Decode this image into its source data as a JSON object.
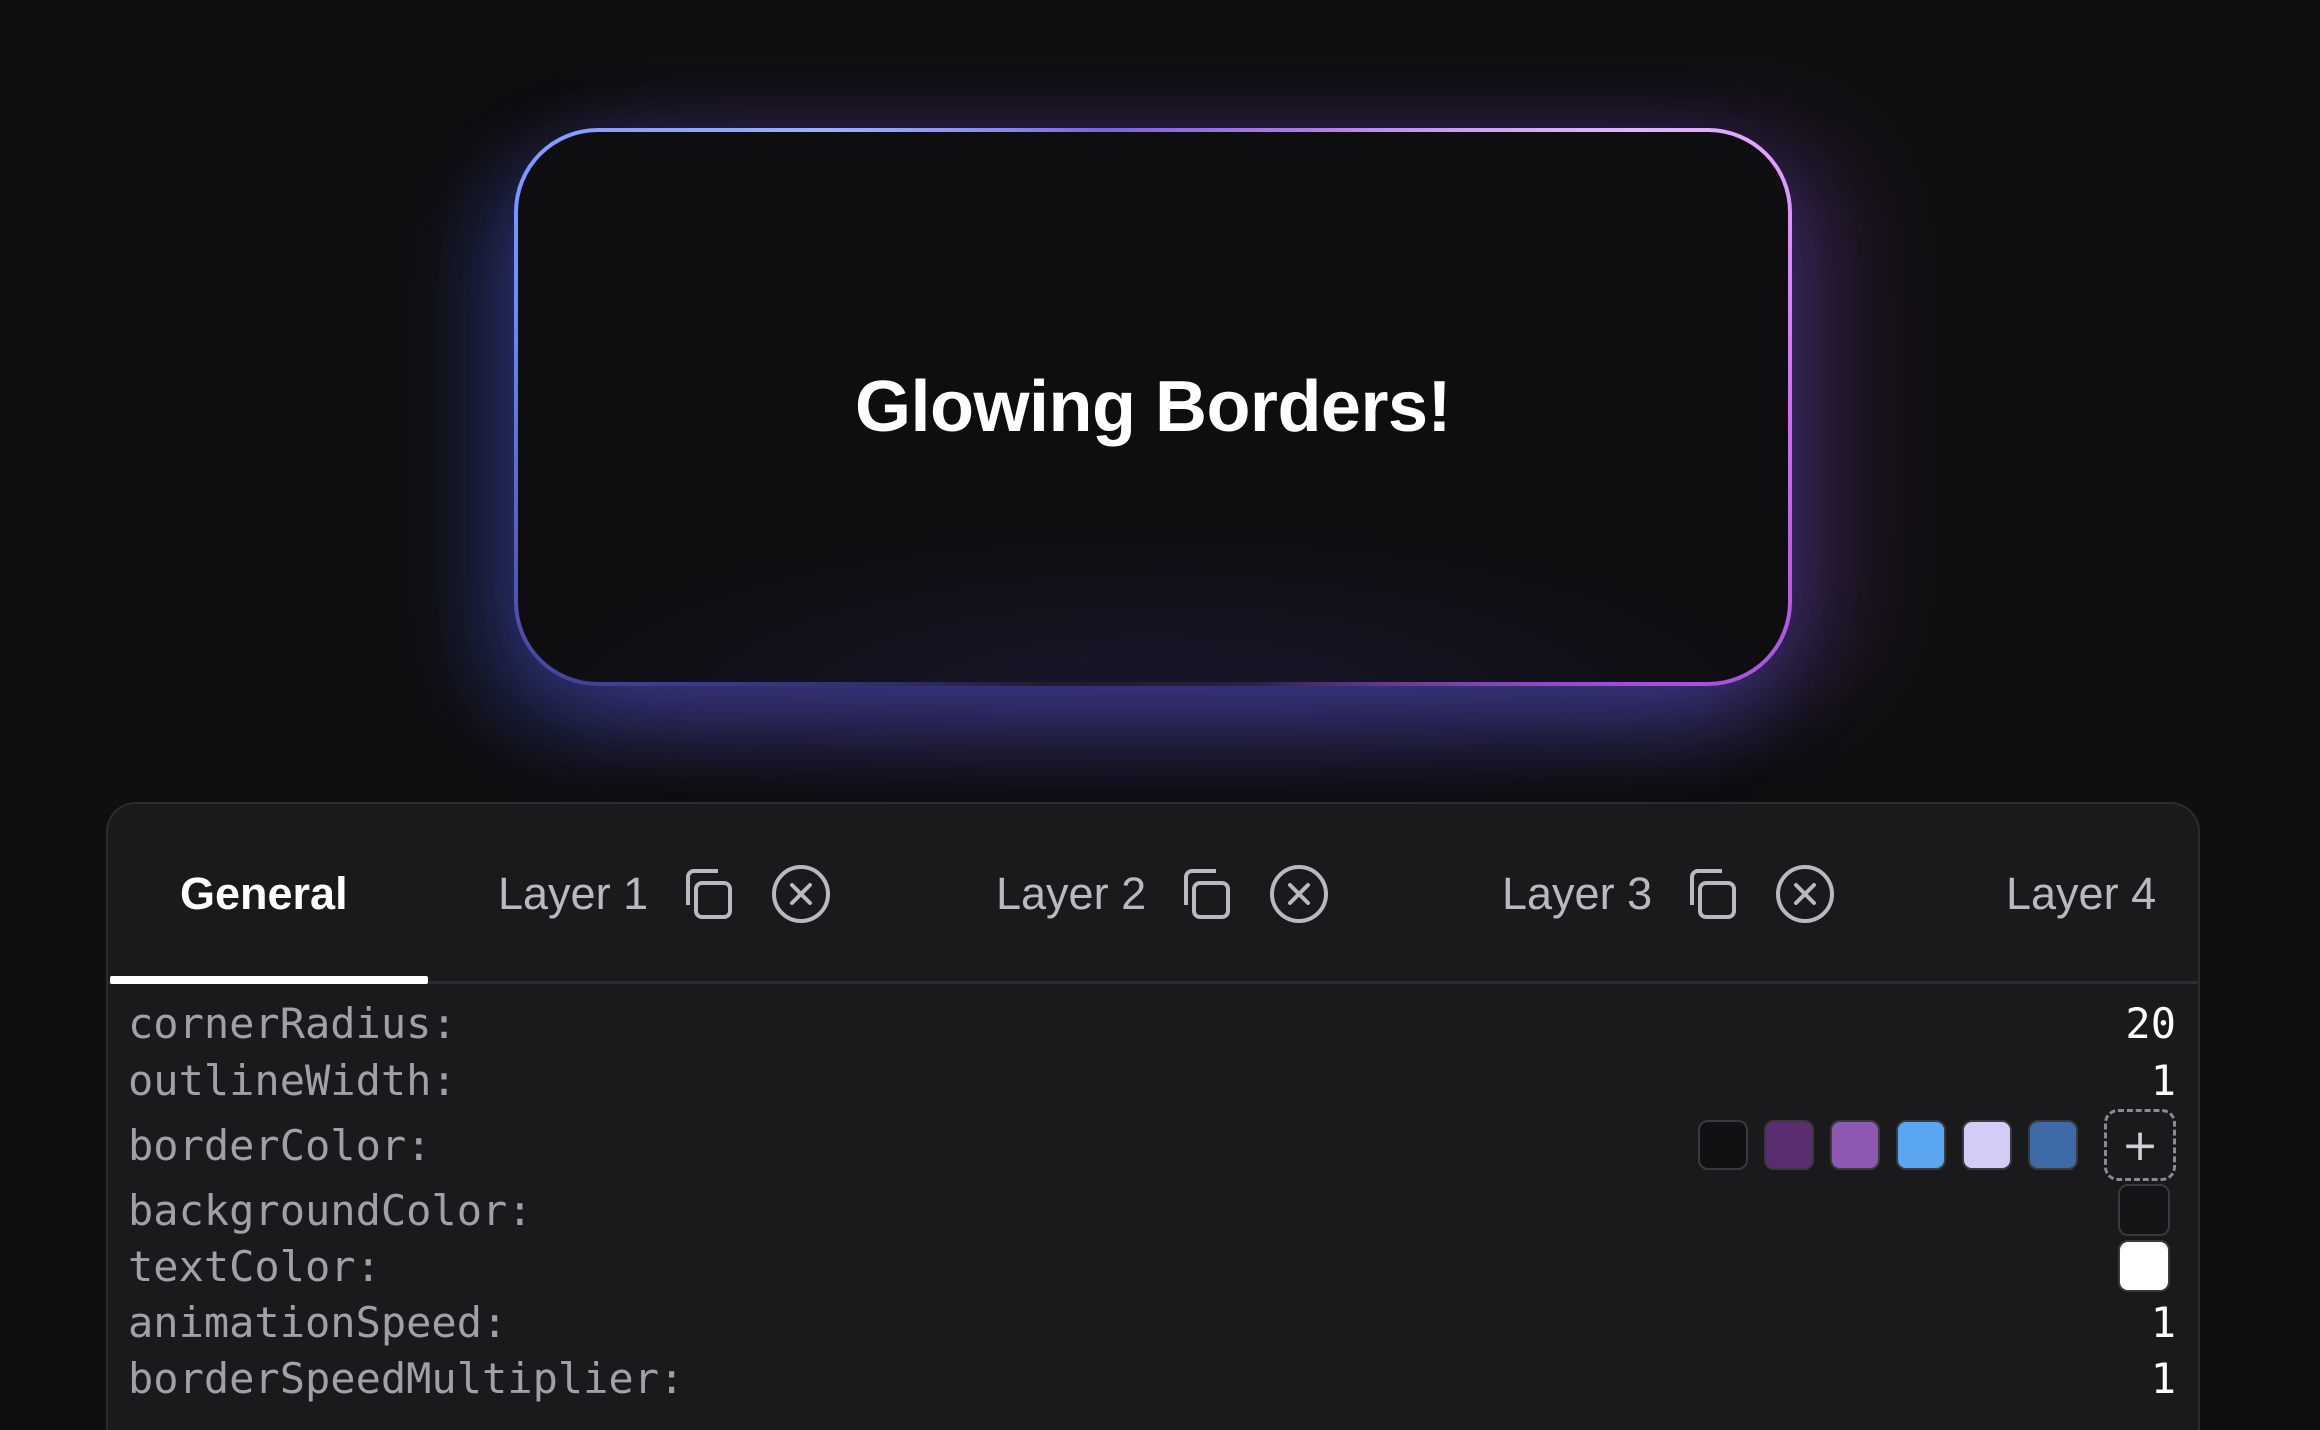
{
  "card": {
    "title": "Glowing Borders!"
  },
  "tabs": [
    {
      "label": "General",
      "active": true
    },
    {
      "label": "Layer 1",
      "active": false
    },
    {
      "label": "Layer 2",
      "active": false
    },
    {
      "label": "Layer 3",
      "active": false
    },
    {
      "label": "Layer 4",
      "active": false
    }
  ],
  "settings": {
    "cornerRadius": {
      "label": "cornerRadius:",
      "value": "20"
    },
    "outlineWidth": {
      "label": "outlineWidth:",
      "value": "1"
    },
    "borderColor": {
      "label": "borderColor:",
      "colors": [
        "#111113",
        "#5a2d6e",
        "#8e58b3",
        "#5aa6f0",
        "#d2cdf7",
        "#3f6aa8"
      ]
    },
    "backgroundColor": {
      "label": "backgroundColor:",
      "color": "#141416"
    },
    "textColor": {
      "label": "textColor:",
      "color": "#ffffff"
    },
    "animationSpeed": {
      "label": "animationSpeed:",
      "value": "1"
    },
    "borderSpeedMultiplier": {
      "label": "borderSpeedMultiplier:",
      "value": "1"
    }
  },
  "icons": {
    "duplicate": "duplicate-icon",
    "close": "close-circle-icon",
    "add": "+"
  }
}
